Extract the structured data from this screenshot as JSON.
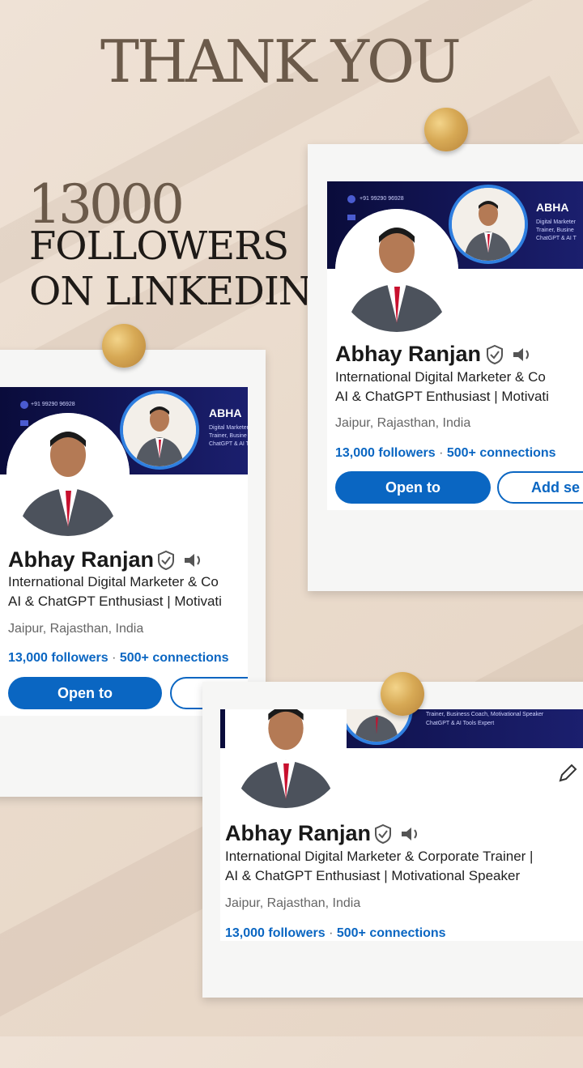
{
  "headline": {
    "title": "THANK YOU",
    "count": "13000",
    "line1": "FOLLOWERS",
    "line2": "ON LINKEDIN"
  },
  "profile": {
    "name": "Abhay Ranjan",
    "headline_line1_full": "International Digital Marketer & Corporate Trainer |",
    "headline_line2_full": "AI & ChatGPT Enthusiast | Motivational Speaker",
    "headline_line1_cut": "International Digital Marketer & Co",
    "headline_line2_cut": "AI & ChatGPT Enthusiast | Motivati",
    "location": "Jaipur, Rajasthan, India",
    "followers": "13,000 followers",
    "separator": "·",
    "connections": "500+ connections",
    "open_to_label": "Open to",
    "add_section_label": "Add se",
    "banner_name": "ABHA",
    "banner_phone": "+91 99290 96928",
    "banner_small": "Digital Marketer\nTrainer, Busine\nChatGPT & AI T",
    "banner_bottom": "ChatGPT & AI Tools Expert",
    "banner_bottom_top": "Trainer, Business Coach, Motivational Speaker"
  },
  "colors": {
    "linkedin_blue": "#0a66c2",
    "banner_navy": "#0a0c3b",
    "pin_gold": "#d7a955"
  },
  "icons": [
    "verified-shield-icon",
    "speaker-icon",
    "phone-icon",
    "mail-icon",
    "pencil-icon"
  ]
}
